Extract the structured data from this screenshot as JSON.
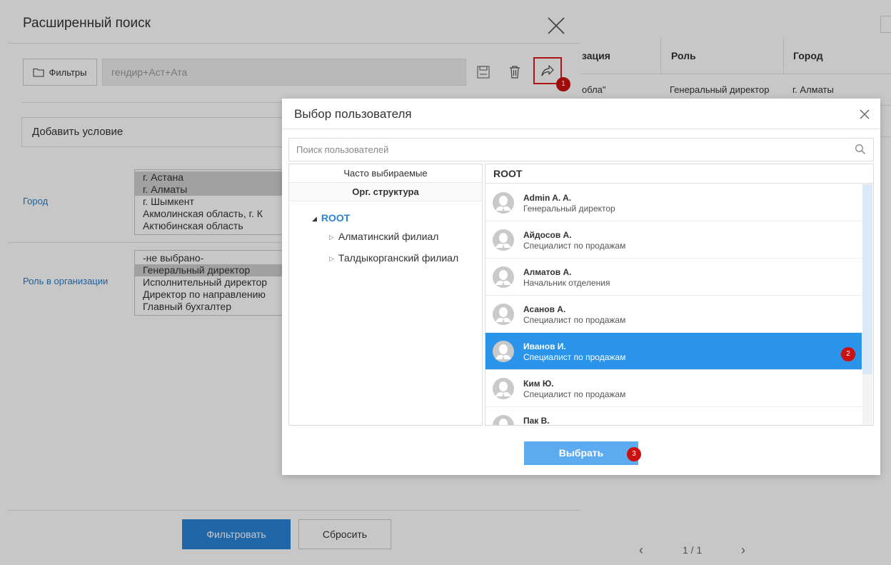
{
  "background_table": {
    "columns": [
      "зация",
      "Роль",
      "Город"
    ],
    "row": [
      "обла\"",
      "Генеральный директор",
      "г. Алматы"
    ],
    "pager": {
      "prev": "‹",
      "page": "1 / 1",
      "next": "›"
    }
  },
  "search_panel": {
    "title": "Расширенный поиск",
    "filters_label": "Фильтры",
    "filter_name": "гендир+Аст+Ата",
    "add_condition_label": "Добавить условие",
    "city": {
      "label": "Город",
      "options": [
        {
          "text": "г. Астана",
          "selected": true
        },
        {
          "text": "г. Алматы",
          "selected": true
        },
        {
          "text": "г. Шымкент",
          "selected": false
        },
        {
          "text": "Акмолинская область, г. К",
          "selected": false
        },
        {
          "text": "Актюбинская область",
          "selected": false
        }
      ]
    },
    "role": {
      "label": "Роль в организации",
      "options": [
        {
          "text": "-не выбрано-",
          "selected": false
        },
        {
          "text": "Генеральный директор",
          "selected": true
        },
        {
          "text": "Исполнительный директор",
          "selected": false
        },
        {
          "text": "Директор по направлению",
          "selected": false
        },
        {
          "text": "Главный бухгалтер",
          "selected": false
        }
      ]
    },
    "filter_button": "Фильтровать",
    "reset_button": "Сбросить",
    "badge_share": "1"
  },
  "user_dialog": {
    "title": "Выбор пользователя",
    "search_placeholder": "Поиск пользователей",
    "tabs": [
      "Часто выбираемые",
      "Орг. структура"
    ],
    "tree": {
      "root": "ROOT",
      "children": [
        "Алматинский филиал",
        "Талдыкорганский филиал"
      ]
    },
    "list_header": "ROOT",
    "users": [
      {
        "name": "Admin A. A.",
        "role": "Генеральный директор",
        "selected": false
      },
      {
        "name": "Айдосов А.",
        "role": "Специалист по продажам",
        "selected": false
      },
      {
        "name": "Алматов А.",
        "role": "Начальник отделения",
        "selected": false
      },
      {
        "name": "Асанов А.",
        "role": "Специалист по продажам",
        "selected": false
      },
      {
        "name": "Иванов И.",
        "role": "Специалист по продажам",
        "selected": true
      },
      {
        "name": "Ким Ю.",
        "role": "Специалист по продажам",
        "selected": false
      },
      {
        "name": "Пак В.",
        "role": "",
        "selected": false
      }
    ],
    "select_button": "Выбрать",
    "badge_selected": "2",
    "badge_select": "3"
  },
  "colors": {
    "primary": "#2a84d8",
    "selected_row": "#2a93ea",
    "badge": "#cc1010",
    "link": "#2a7cc7"
  }
}
